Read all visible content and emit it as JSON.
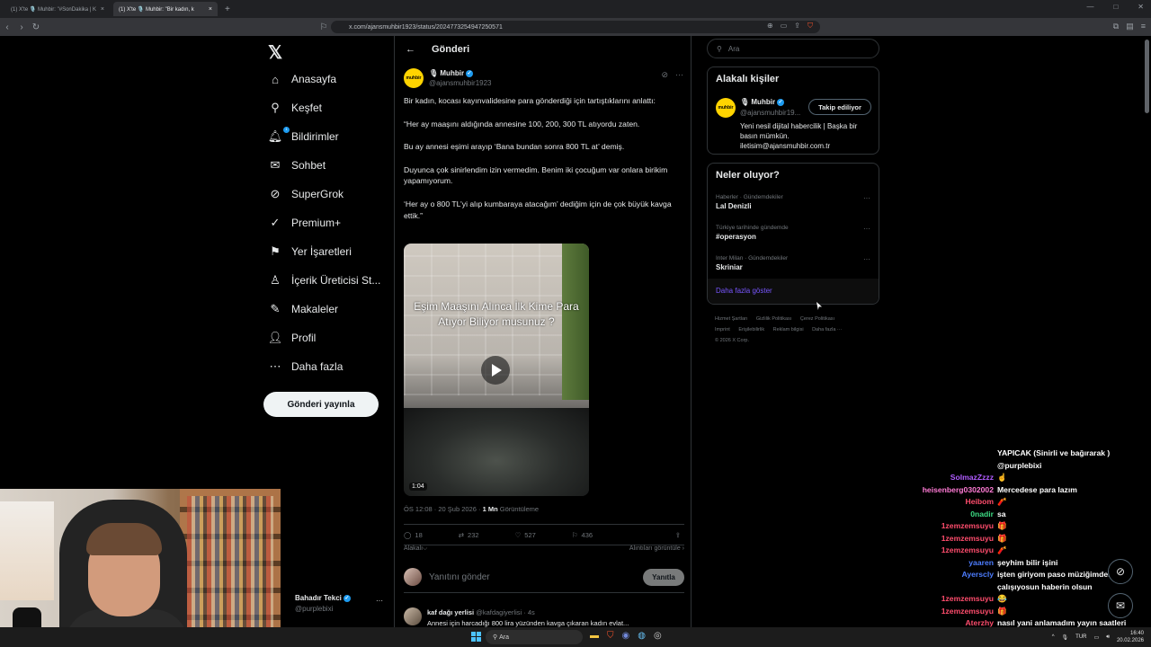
{
  "browser": {
    "tabs": [
      {
        "label": "(1) X'te 🎙️ Muhbir: \"#SonDakika | K",
        "active": false
      },
      {
        "label": "(1) X'te 🎙️ Muhbir: \"Bir kadın, k",
        "active": true
      }
    ],
    "url": "x.com/ajansmuhbir1923/status/2024773254947250571"
  },
  "nav": {
    "logo": "𝕏",
    "items": [
      {
        "label": "Anasayfa",
        "icon": "home-icon",
        "glyph": "⌂"
      },
      {
        "label": "Keşfet",
        "icon": "search-icon",
        "glyph": "⚲"
      },
      {
        "label": "Bildirimler",
        "icon": "bell-icon",
        "glyph": "🔔︎"
      },
      {
        "label": "Sohbet",
        "icon": "mail-icon",
        "glyph": "✉"
      },
      {
        "label": "SuperGrok",
        "icon": "grok-icon",
        "glyph": "⊘"
      },
      {
        "label": "Premium+",
        "icon": "premium-icon",
        "glyph": "✓"
      },
      {
        "label": "Yer İşaretleri",
        "icon": "bookmark-icon",
        "glyph": "⚑"
      },
      {
        "label": "İçerik Üreticisi St...",
        "icon": "creator-studio-icon",
        "glyph": "♙"
      },
      {
        "label": "Makaleler",
        "icon": "article-icon",
        "glyph": "✎"
      },
      {
        "label": "Profil",
        "icon": "person-icon",
        "glyph": "👤︎"
      },
      {
        "label": "Daha fazla",
        "icon": "more-circle-icon",
        "glyph": "⋯"
      }
    ],
    "notification_count": "1",
    "post_button": "Gönderi yayınla"
  },
  "main": {
    "header_title": "Gönderi",
    "author_name": "Muhbir",
    "author_handle": "@ajansmuhbir1923",
    "avatar_text": "muhbir",
    "paragraphs": [
      "Bir kadın, kocası kayınvalidesine para gönderdiği için tartıştıklarını anlattı:",
      "“Her ay maaşını aldığında annesine 100, 200, 300 TL atıyordu zaten.",
      "Bu ay annesi eşimi arayıp ‘Bana bundan sonra 800 TL at’ demiş.",
      "Duyunca çok sinirlendim izin vermedim. Benim iki çocuğum var onlara birikim yapamıyorum.",
      "‘Her ay o 800 TL’yi alıp kumbaraya atacağım’ dediğim için de çok büyük kavga ettik.”"
    ],
    "video_caption": "Eşim Maaşını Alınca İlk Kime Para Atıyor Biliyor musunuz ?",
    "video_duration": "1:04",
    "timestamp": "ÖS 12:08 · 20 Şub 2026 · ",
    "views_count": "1 Mn",
    "views_label": " Görüntüleme",
    "replies": "18",
    "reposts": "232",
    "likes": "527",
    "bookmarks": "436",
    "related_left": "Alakalı⌵",
    "related_right": "Alıntıları görüntüle ›",
    "reply_placeholder": "Yanıtını gönder",
    "reply_button": "Yanıtla",
    "next_post_name": "kaf dağı yerlisi",
    "next_post_handle": "@kafdagiyerlisi · 4s",
    "next_post_text": "Annesi için harcadığı 800 lira yüzünden kavga çıkaran kadın evlat..."
  },
  "right": {
    "search_placeholder": "Ara",
    "who_title": "Alakalı kişiler",
    "who_name": "Muhbir",
    "who_handle": "@ajansmuhbir19...",
    "who_follow": "Takip ediliyor",
    "who_bio": "Yeni nesil dijital habercilik | Başka bir basın mümkün. iletisim@ajansmuhbir.com.tr",
    "trends_title": "Neler oluyor?",
    "trends": [
      {
        "category": "Haberler · Gündemdekiler",
        "name": "Lal Denizli"
      },
      {
        "category": "Türkiye tarihinde gündemde",
        "name": "#operasyon"
      },
      {
        "category": "Inter Milan · Gündemdekiler",
        "name": "Skriniar"
      }
    ],
    "show_more": "Daha fazla göster",
    "footer": [
      "Hizmet Şartları",
      "Gizlilik Politikası",
      "Çerez Politikası",
      "Imprint",
      "Erişilebilirlik",
      "Reklam bilgisi",
      "Daha fazla ···",
      "© 2026 X Corp."
    ]
  },
  "streamer": {
    "name": "Bahadır Tekci",
    "handle": "@purplebixi"
  },
  "chat": [
    {
      "user": "",
      "msg": "YAPICAK (Sinirli ve bağırarak )",
      "color": "#ffffff"
    },
    {
      "user": "",
      "msg": "@purplebixi",
      "color": "#ffffff"
    },
    {
      "user": "SolmazZzzz",
      "msg": "☝",
      "color": "#b05cff"
    },
    {
      "user": "heisenberg0302002",
      "msg": "Mercedese para lazım",
      "color": "#ff7bd5"
    },
    {
      "user": "Heibom",
      "msg": "🧨",
      "color": "#ff4d6d"
    },
    {
      "user": "0nadir",
      "msg": "sa",
      "color": "#3ddc84"
    },
    {
      "user": "1zemzemsuyu",
      "msg": "🎁",
      "color": "#ff4d6d"
    },
    {
      "user": "1zemzemsuyu",
      "msg": "🎁",
      "color": "#ff4d6d"
    },
    {
      "user": "1zemzemsuyu",
      "msg": "🧨",
      "color": "#ff4d6d"
    },
    {
      "user": "yaaren",
      "msg": "şeyhim bilir işini",
      "color": "#4d7dff"
    },
    {
      "user": "Ayerscly",
      "msg": "işten giriyom paso müziğimden çalışıyosun haberin olsun",
      "color": "#4d7dff",
      "tall": true
    },
    {
      "user": "1zemzemsuyu",
      "msg": "😂",
      "color": "#ff4d6d"
    },
    {
      "user": "1zemzemsuyu",
      "msg": "🎁",
      "color": "#ff4d6d"
    },
    {
      "user": "Aterzhy",
      "msg": "nasıl yani anlamadım yayın saatleri mi değişti",
      "color": "#ff4d6d",
      "tall": true
    }
  ],
  "taskbar": {
    "search": "Ara",
    "lang": "TUR",
    "time": "16:40",
    "date": "20.02.2026"
  }
}
